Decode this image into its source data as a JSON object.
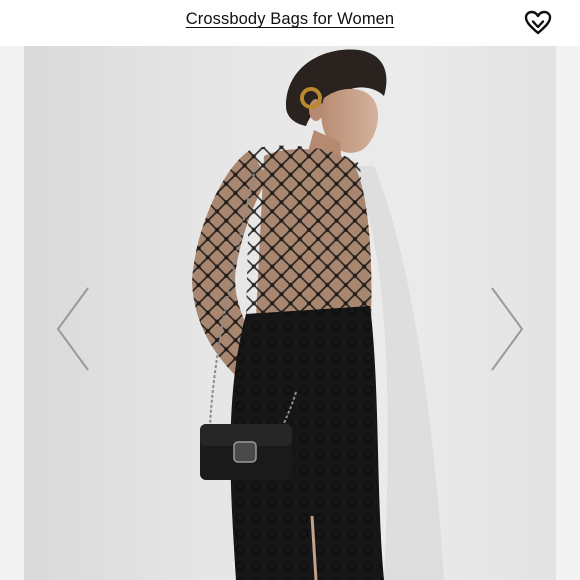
{
  "header": {
    "title": "Crossbody Bags for Women"
  },
  "icons": {
    "favorite": "heart-icon",
    "prev": "chevron-left-icon",
    "next": "chevron-right-icon"
  },
  "colors": {
    "background": "#ebebeb",
    "outfit": "#141414",
    "skin": "#c9a48a",
    "accent": "#111111"
  }
}
